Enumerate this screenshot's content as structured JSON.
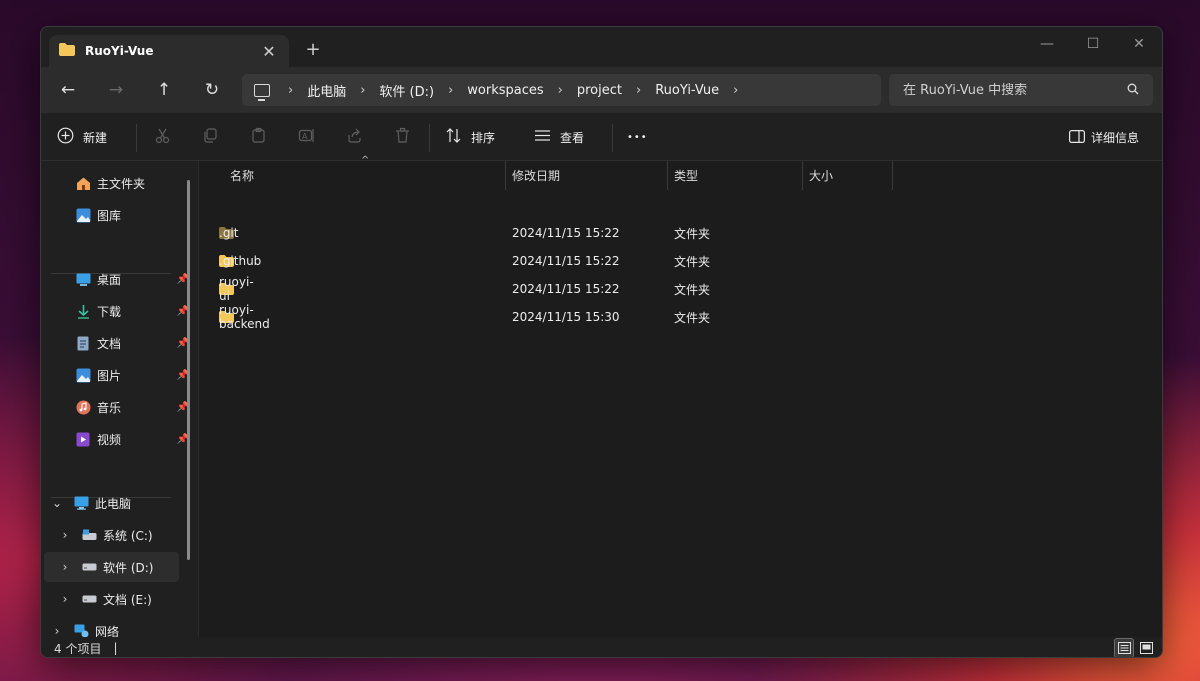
{
  "tab": {
    "title": "RuoYi-Vue",
    "close": "✕",
    "new_tab": "+"
  },
  "window_controls": {
    "minimize": "—",
    "maximize": "☐",
    "close": "✕"
  },
  "nav": {
    "back": "←",
    "forward": "→",
    "up": "↑",
    "refresh": "↻"
  },
  "breadcrumb": [
    "此电脑",
    "软件 (D:)",
    "workspaces",
    "project",
    "RuoYi-Vue"
  ],
  "search": {
    "placeholder": "在 RuoYi-Vue 中搜索"
  },
  "toolbar": {
    "new_label": "新建",
    "sort_label": "排序",
    "view_label": "查看",
    "more": "•••",
    "details_label": "详细信息"
  },
  "sidebar": {
    "quick": [
      {
        "label": "主文件夹",
        "icon": "home-icon"
      },
      {
        "label": "图库",
        "icon": "gallery-icon"
      }
    ],
    "pinned": [
      {
        "label": "桌面",
        "icon": "desktop-icon"
      },
      {
        "label": "下载",
        "icon": "download-icon"
      },
      {
        "label": "文档",
        "icon": "documents-icon"
      },
      {
        "label": "图片",
        "icon": "pictures-icon"
      },
      {
        "label": "音乐",
        "icon": "music-icon"
      },
      {
        "label": "视频",
        "icon": "videos-icon"
      }
    ],
    "this_pc": "此电脑",
    "drives": [
      {
        "label": "系统 (C:)"
      },
      {
        "label": "软件 (D:)",
        "selected": true
      },
      {
        "label": "文档 (E:)"
      }
    ],
    "network": "网络"
  },
  "columns": {
    "name": "名称",
    "modified": "修改日期",
    "type": "类型",
    "size": "大小"
  },
  "files": [
    {
      "name": ".git",
      "modified": "2024/11/15 15:22",
      "type": "文件夹",
      "dim": true
    },
    {
      "name": ".github",
      "modified": "2024/11/15 15:22",
      "type": "文件夹"
    },
    {
      "name": "ruoyi-ui",
      "modified": "2024/11/15 15:22",
      "type": "文件夹"
    },
    {
      "name": "ruoyi-backend",
      "modified": "2024/11/15 15:30",
      "type": "文件夹"
    }
  ],
  "status": {
    "item_count": "4 个项目",
    "cursor": "|"
  },
  "colors": {
    "folder": "#f4c75a",
    "folder_dim": "#8a7440",
    "accent": "#4ea0e6"
  }
}
